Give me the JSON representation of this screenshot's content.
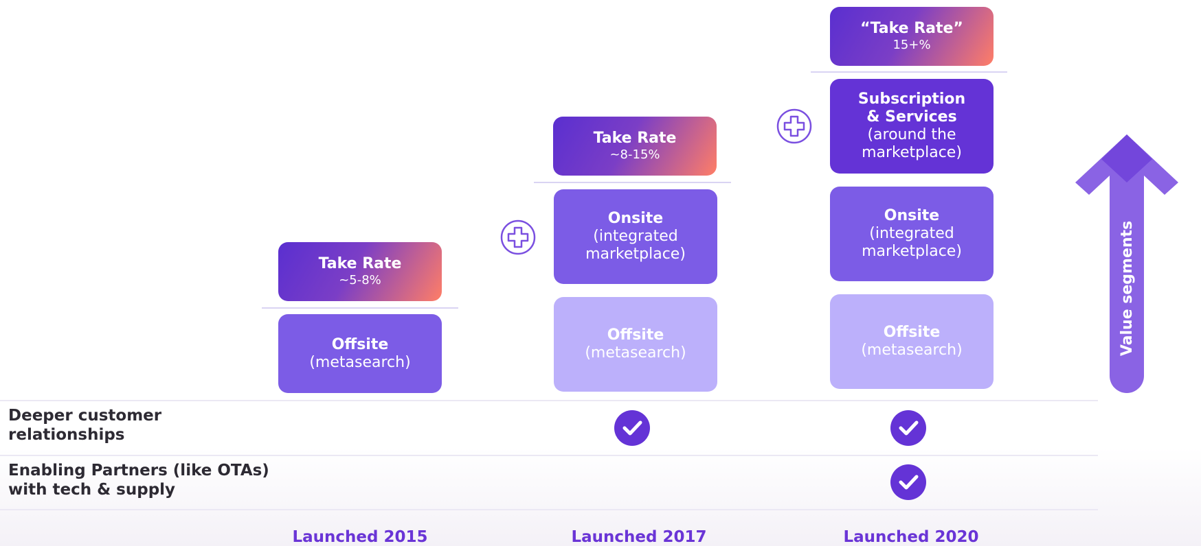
{
  "columns": [
    {
      "take_rate": {
        "title": "Take Rate",
        "value": "~5-8%"
      },
      "offsite": {
        "title": "Offsite",
        "sub": "(metasearch)"
      },
      "launched": "Launched 2015"
    },
    {
      "take_rate": {
        "title": "Take Rate",
        "value": "~8-15%"
      },
      "onsite": {
        "title": "Onsite",
        "sub1": "(integrated",
        "sub2": "marketplace)"
      },
      "offsite": {
        "title": "Offsite",
        "sub": "(metasearch)"
      },
      "launched": "Launched 2017"
    },
    {
      "take_rate": {
        "title": "“Take Rate”",
        "value": "15+%"
      },
      "subscription": {
        "title1": "Subscription",
        "title2": "& Services",
        "sub1": "(around the",
        "sub2": "marketplace)"
      },
      "onsite": {
        "title": "Onsite",
        "sub1": "(integrated",
        "sub2": "marketplace)"
      },
      "offsite": {
        "title": "Offsite",
        "sub": "(metasearch)"
      },
      "launched": "Launched 2020"
    }
  ],
  "rows": [
    {
      "line1": "Deeper customer",
      "line2": "relationships",
      "checks": [
        false,
        true,
        true
      ]
    },
    {
      "line1": "Enabling Partners (like OTAs)",
      "line2": "with tech & supply",
      "checks": [
        false,
        false,
        true
      ]
    }
  ],
  "arrow_label": "Value segments",
  "colors": {
    "purple_deep": "#6433d6",
    "purple_mid": "#7c5ce6",
    "purple_light": "#bcb0fb",
    "accent_orange": "#ff7e66",
    "launch_text": "#6a34d6"
  }
}
